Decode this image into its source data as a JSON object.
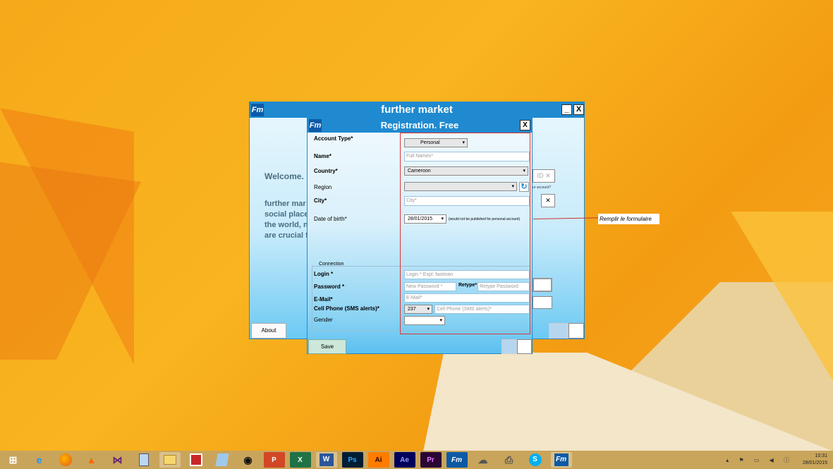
{
  "main_window": {
    "title": "further market",
    "minimize": "_",
    "close": "X",
    "welcome": "Welcome.",
    "intro_lines": [
      "further mar",
      "social place",
      "the world, n",
      "are crucial f"
    ],
    "about": "About",
    "right_fragments": {
      "id": "ID",
      "account": "ur account?"
    }
  },
  "registration": {
    "title": "Registration. Free",
    "close": "X",
    "account_type": {
      "label": "Account Type*",
      "value": "Personal"
    },
    "name": {
      "label": "Name*",
      "placeholder": "Full Names*"
    },
    "country": {
      "label": "Country*",
      "value": "Cameroon"
    },
    "region": {
      "label": "Region",
      "value": ""
    },
    "city": {
      "label": "City*",
      "placeholder": "City*"
    },
    "dob": {
      "label": "Date of birth*",
      "value": "28/01/2015",
      "note": "(would not be published for personal account)"
    },
    "connection": {
      "title": "Connection",
      "login": {
        "label": "Login *",
        "placeholder": "Login * Expl: fastman"
      },
      "password": {
        "label": "Password *",
        "placeholder": "New Password *"
      },
      "retype": {
        "label": "Retype*",
        "placeholder": "Retype Password"
      },
      "email": {
        "label": "E-Mail*",
        "placeholder": "E-Mail*"
      },
      "cell": {
        "label": "Cell Phone (SMS alerts)*",
        "code": "237",
        "placeholder": "Cell Phone (SMS alerts)*"
      },
      "gender": {
        "label": "Gender",
        "value": ""
      }
    },
    "save": "Save"
  },
  "annotation": "Remplir le formulaire",
  "taskbar": {
    "icons": [
      "windows-logo",
      "ie",
      "firefox",
      "vlc",
      "visual-studio",
      "notepad",
      "file-explorer",
      "flashcard",
      "app",
      "camera",
      "powerpoint",
      "excel",
      "word",
      "photoshop",
      "illustrator",
      "after-effects",
      "premiere",
      "further-market",
      "network",
      "printer",
      "skype",
      "further-market-active"
    ],
    "time": "10:31",
    "date": "28/01/2015"
  },
  "colors": {
    "accent": "#1f8ad0",
    "annotation_border": "#dd3333"
  }
}
